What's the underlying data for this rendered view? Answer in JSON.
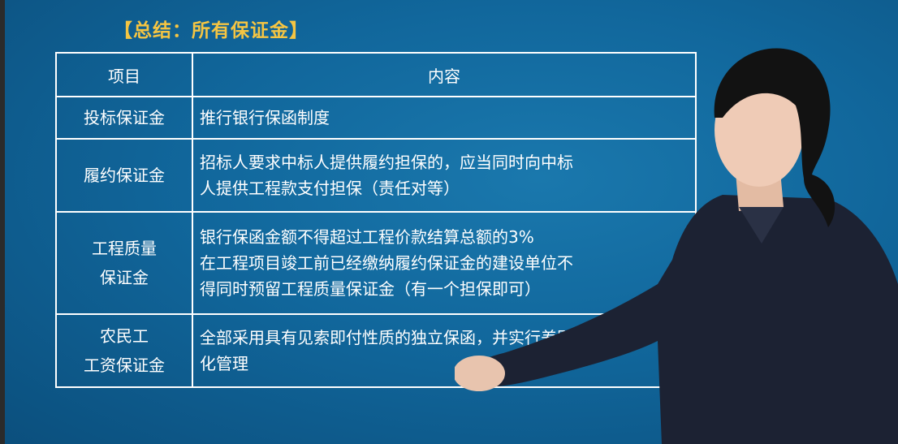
{
  "slide": {
    "title": "【总结：所有保证金】"
  },
  "table": {
    "headers": [
      "项目",
      "内容"
    ],
    "rows": [
      {
        "item": [
          "投标保证金"
        ],
        "content": [
          "推行银行保函制度"
        ]
      },
      {
        "item": [
          "履约保证金"
        ],
        "content": [
          "招标人要求中标人提供履约担保的，应当同时向中标",
          "人提供工程款支付担保（责任对等）"
        ]
      },
      {
        "item": [
          "工程质量",
          "保证金"
        ],
        "content": [
          "银行保函金额不得超过工程价款结算总额的3%",
          "在工程项目竣工前已经缴纳履约保证金的建设单位不",
          "得同时预留工程质量保证金（有一个担保即可）"
        ]
      },
      {
        "item": [
          "农民工",
          "工资保证金"
        ],
        "content": [
          "全部采用具有见索即付性质的独立保函，并实行差别",
          "化管理"
        ]
      }
    ]
  },
  "colors": {
    "background": "#11679c",
    "title": "#f5c542",
    "text": "#ffffff"
  }
}
